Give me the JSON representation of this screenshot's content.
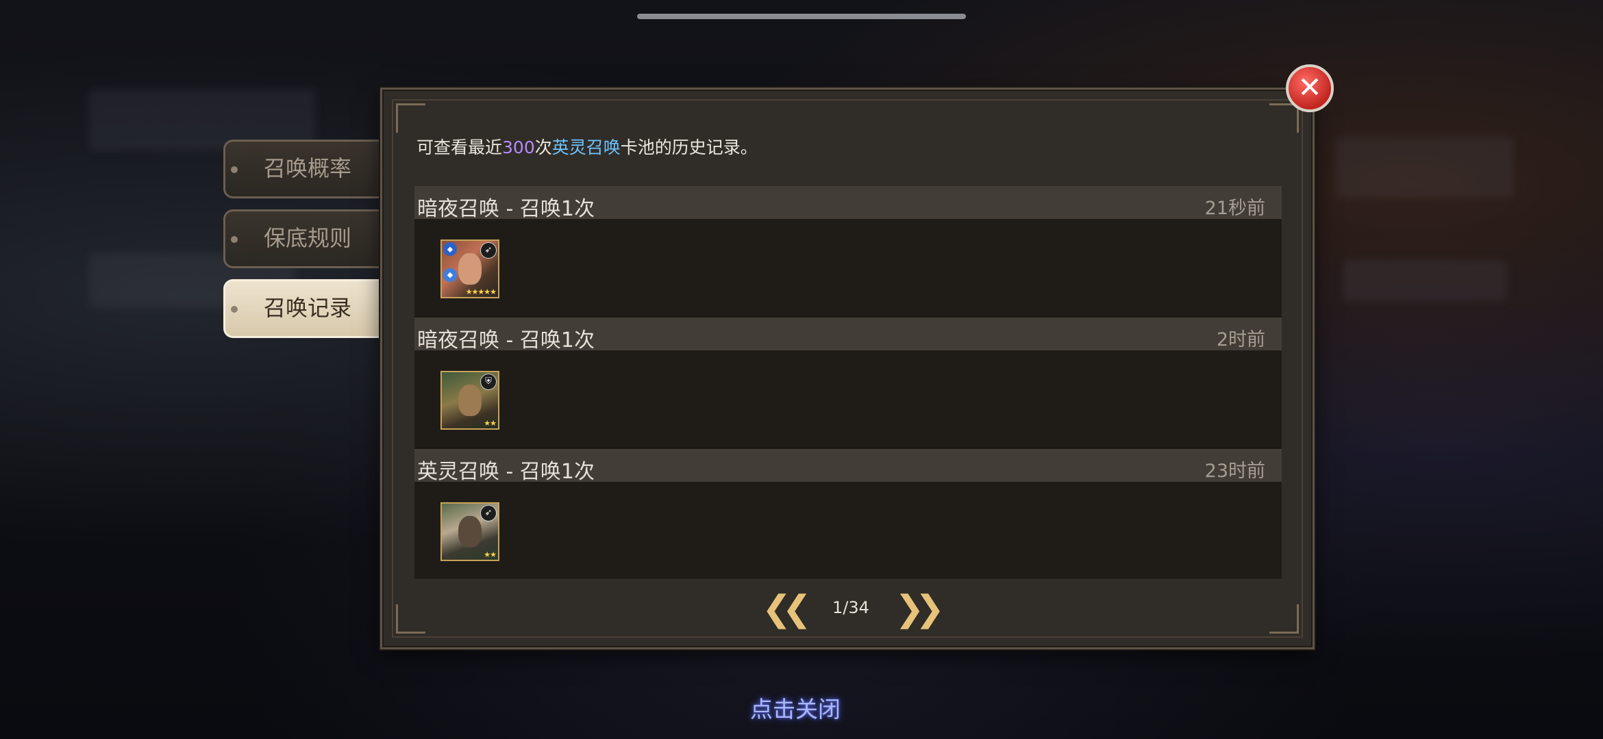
{
  "description": {
    "prefix": "可查看最近",
    "count": "300",
    "middle": "次",
    "pool": "英灵召唤",
    "suffix": "卡池的历史记录。"
  },
  "tabs": [
    {
      "label": "召唤概率",
      "active": false
    },
    {
      "label": "保底规则",
      "active": false
    },
    {
      "label": "召唤记录",
      "active": true
    }
  ],
  "records": [
    {
      "title": "暗夜召唤 - 召唤1次",
      "time": "21秒前",
      "hero_stars": "★★★★★",
      "hero_icon": "hero-portrait-icon"
    },
    {
      "title": "暗夜召唤 - 召唤1次",
      "time": "2时前",
      "hero_stars": "★★",
      "hero_icon": "hero-portrait-icon"
    },
    {
      "title": "英灵召唤 - 召唤1次",
      "time": "23时前",
      "hero_stars": "★★",
      "hero_icon": "hero-portrait-icon"
    }
  ],
  "pagination": {
    "page": "1/34",
    "prev_icon": "double-chevron-left-icon",
    "next_icon": "double-chevron-right-icon"
  },
  "footer": {
    "tap_to_close": "点击关闭"
  },
  "colors": {
    "highlight_count": "#b48cff",
    "highlight_pool": "#6cc5ff",
    "close_button": "#c22520",
    "arrow": "#e6c27a"
  }
}
